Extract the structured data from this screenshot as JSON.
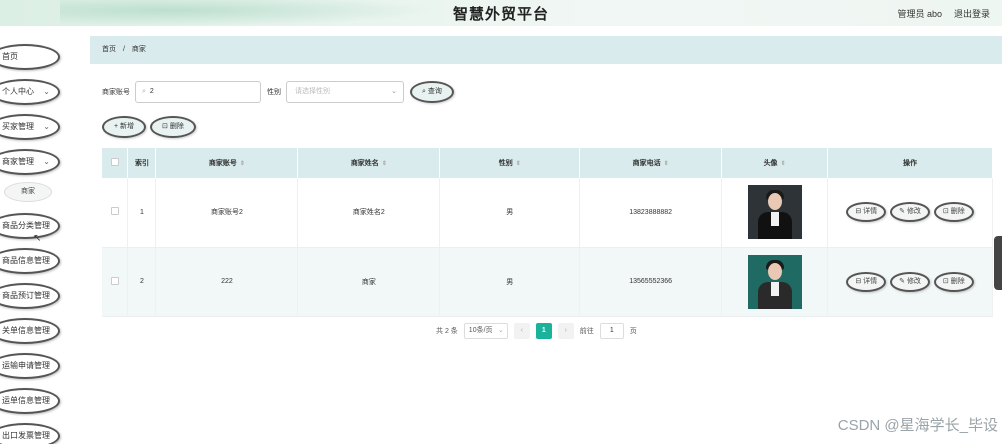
{
  "header": {
    "title": "智慧外贸平台",
    "admin": "管理员 abo",
    "logout": "退出登录"
  },
  "sidebar": {
    "items": [
      {
        "label": "首页",
        "expandable": false
      },
      {
        "label": "个人中心",
        "expandable": true
      },
      {
        "label": "买家管理",
        "expandable": true
      },
      {
        "label": "商家管理",
        "expandable": true
      },
      {
        "label": "商品分类管理",
        "expandable": false
      },
      {
        "label": "商品信息管理",
        "expandable": false
      },
      {
        "label": "商品预订管理",
        "expandable": false
      },
      {
        "label": "关单信息管理",
        "expandable": false
      },
      {
        "label": "运输申请管理",
        "expandable": false
      },
      {
        "label": "运单信息管理",
        "expandable": false
      },
      {
        "label": "出口发票管理",
        "expandable": false
      }
    ],
    "submenu": {
      "label": "商家"
    }
  },
  "breadcrumb": {
    "home": "首页",
    "sep": "/",
    "current": "商家"
  },
  "search": {
    "account_label": "商家账号",
    "account_value": "2",
    "gender_label": "性别",
    "gender_placeholder": "请选择性别",
    "query_button": "查询"
  },
  "actions": {
    "add": "新增",
    "delete": "删除"
  },
  "table": {
    "columns": [
      "索引",
      "商家账号",
      "商家姓名",
      "性别",
      "商家电话",
      "头像",
      "操作"
    ],
    "rows": [
      {
        "index": "1",
        "account": "商家账号2",
        "name": "商家姓名2",
        "gender": "男",
        "phone": "13823888882"
      },
      {
        "index": "2",
        "account": "222",
        "name": "商家",
        "gender": "男",
        "phone": "13565552366"
      }
    ],
    "row_actions": {
      "detail": "详情",
      "edit": "修改",
      "delete": "删除"
    }
  },
  "pagination": {
    "total": "共 2 条",
    "page_size": "10条/页",
    "current_page": "1",
    "goto_label": "前往",
    "goto_value": "1",
    "page_unit": "页"
  },
  "watermark": "CSDN @星海学长_毕设",
  "colors": {
    "accent": "#19b29b",
    "header_bg": "#d9ebec"
  }
}
